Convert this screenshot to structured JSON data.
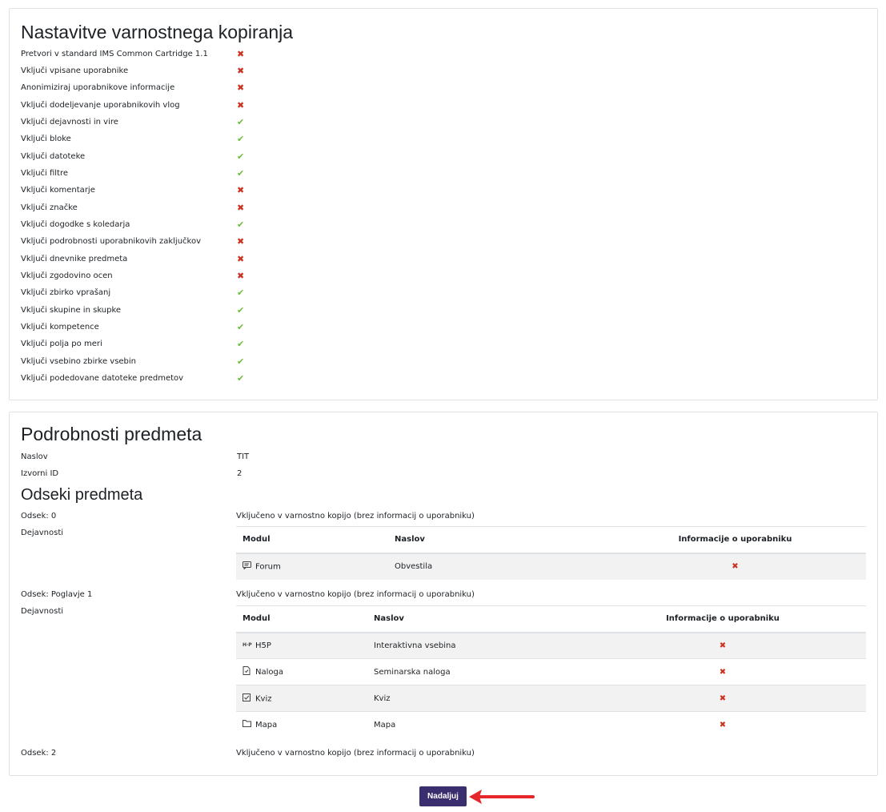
{
  "settings": {
    "title": "Nastavitve varnostnega kopiranja",
    "items": [
      {
        "label": "Pretvori v standard IMS Common Cartridge 1.1",
        "enabled": false
      },
      {
        "label": "Vključi vpisane uporabnike",
        "enabled": false
      },
      {
        "label": "Anonimiziraj uporabnikove informacije",
        "enabled": false
      },
      {
        "label": "Vključi dodeljevanje uporabnikovih vlog",
        "enabled": false
      },
      {
        "label": "Vključi dejavnosti in vire",
        "enabled": true
      },
      {
        "label": "Vključi bloke",
        "enabled": true
      },
      {
        "label": "Vključi datoteke",
        "enabled": true
      },
      {
        "label": "Vključi filtre",
        "enabled": true
      },
      {
        "label": "Vključi komentarje",
        "enabled": false
      },
      {
        "label": "Vključi značke",
        "enabled": false
      },
      {
        "label": "Vključi dogodke s koledarja",
        "enabled": true
      },
      {
        "label": "Vključi podrobnosti uporabnikovih zaključkov",
        "enabled": false
      },
      {
        "label": "Vključi dnevnike predmeta",
        "enabled": false
      },
      {
        "label": "Vključi zgodovino ocen",
        "enabled": false
      },
      {
        "label": "Vključi zbirko vprašanj",
        "enabled": true
      },
      {
        "label": "Vključi skupine in skupke",
        "enabled": true
      },
      {
        "label": "Vključi kompetence",
        "enabled": true
      },
      {
        "label": "Vključi polja po meri",
        "enabled": true
      },
      {
        "label": "Vključi vsebino zbirke vsebin",
        "enabled": true
      },
      {
        "label": "Vključi podedovane datoteke predmetov",
        "enabled": true
      }
    ],
    "yes_glyph": "✔",
    "no_glyph": "✖"
  },
  "details": {
    "title": "Podrobnosti predmeta",
    "naslov_label": "Naslov",
    "naslov_value": "TIT",
    "id_label": "Izvorni ID",
    "id_value": "2",
    "sections_title": "Odseki predmeta",
    "included_text": "Vključeno v varnostno kopijo (brez informacij o uporabniku)",
    "activities_label": "Dejavnosti",
    "table_headers": {
      "module": "Modul",
      "title": "Naslov",
      "userinfo": "Informacije o uporabniku"
    },
    "sections": [
      {
        "label": "Odsek: 0",
        "activities": [
          {
            "module": "Forum",
            "icon": "forum-icon",
            "title": "Obvestila"
          }
        ]
      },
      {
        "label": "Odsek: Poglavje 1",
        "activities": [
          {
            "module": "H5P",
            "icon": "h5p-icon",
            "title": "Interaktivna vsebina"
          },
          {
            "module": "Naloga",
            "icon": "assignment-icon",
            "title": "Seminarska naloga"
          },
          {
            "module": "Kviz",
            "icon": "quiz-icon",
            "title": "Kviz"
          },
          {
            "module": "Mapa",
            "icon": "folder-icon",
            "title": "Mapa"
          }
        ]
      },
      {
        "label": "Odsek: 2",
        "activities": []
      }
    ]
  },
  "continue_button": "Nadaljuj",
  "colors": {
    "button": "#3a2e6e",
    "no": "#ca3120",
    "yes": "#6fbb3c",
    "arrow": "#e5262a"
  }
}
